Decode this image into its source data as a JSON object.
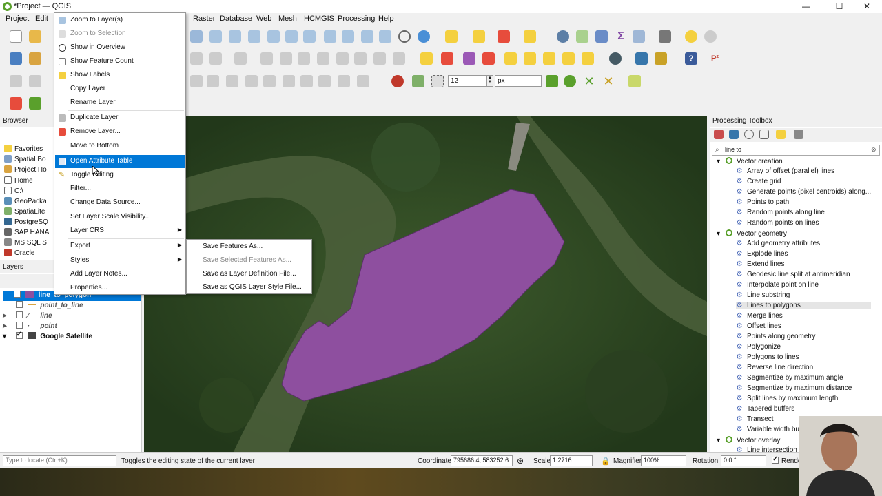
{
  "window": {
    "title": "*Project — QGIS",
    "min": "—",
    "max": "☐",
    "close": "✕"
  },
  "menubar": [
    "Project",
    "Edit",
    "Raster",
    "Database",
    "Web",
    "Mesh",
    "HCMGIS",
    "Processing",
    "Help"
  ],
  "snapping": {
    "tolerance_value": "12",
    "units_value": "px"
  },
  "browser": {
    "title": "Browser",
    "items": [
      "Favorites",
      "Spatial Bo",
      "Project Ho",
      "Home",
      "C:\\",
      "GeoPacka",
      "SpatiaLite",
      "PostgreSQ",
      "SAP HANA",
      "MS SQL S",
      "Oracle"
    ]
  },
  "layers": {
    "title": "Layers",
    "items": [
      {
        "name": "line_to_polygon",
        "checked": true,
        "selected": true
      },
      {
        "name": "point_to_line",
        "checked": false
      },
      {
        "name": "line",
        "checked": false
      },
      {
        "name": "point",
        "checked": false
      },
      {
        "name": "Google Satellite",
        "checked": true
      }
    ]
  },
  "context_menu": {
    "items": [
      {
        "label": "Zoom to Layer(s)"
      },
      {
        "label": "Zoom to Selection",
        "disabled": true
      },
      {
        "label": "Show in Overview"
      },
      {
        "label": "Show Feature Count"
      },
      {
        "label": "Show Labels"
      },
      {
        "label": "Copy Layer"
      },
      {
        "label": "Rename Layer"
      },
      {
        "label": "Duplicate Layer"
      },
      {
        "label": "Remove Layer..."
      },
      {
        "label": "Move to Bottom"
      },
      {
        "label": "Open Attribute Table",
        "highlighted": true
      },
      {
        "label": "Toggle Editing"
      },
      {
        "label": "Filter..."
      },
      {
        "label": "Change Data Source..."
      },
      {
        "label": "Set Layer Scale Visibility..."
      },
      {
        "label": "Layer CRS"
      },
      {
        "label": "Export"
      },
      {
        "label": "Styles"
      },
      {
        "label": "Add Layer Notes..."
      },
      {
        "label": "Properties..."
      }
    ]
  },
  "export_submenu": {
    "items": [
      {
        "label": "Save Features As..."
      },
      {
        "label": "Save Selected Features As...",
        "disabled": true
      },
      {
        "label": "Save as Layer Definition File..."
      },
      {
        "label": "Save as QGIS Layer Style File..."
      }
    ]
  },
  "processing": {
    "title": "Processing Toolbox",
    "search": "line to",
    "groups": [
      {
        "name": "Vector creation",
        "items": [
          "Array of offset (parallel) lines",
          "Create grid",
          "Generate points (pixel centroids) along...",
          "Points to path",
          "Random points along line",
          "Random points on lines"
        ]
      },
      {
        "name": "Vector geometry",
        "items": [
          "Add geometry attributes",
          "Explode lines",
          "Extend lines",
          "Geodesic line split at antimeridian",
          "Interpolate point on line",
          "Line substring",
          "Lines to polygons",
          "Merge lines",
          "Offset lines",
          "Points along geometry",
          "Polygonize",
          "Polygons to lines",
          "Reverse line direction",
          "Segmentize by maximum angle",
          "Segmentize by maximum distance",
          "Split lines by maximum length",
          "Tapered buffers",
          "Transect",
          "Variable width bu"
        ]
      },
      {
        "name": "Vector overlay",
        "items": [
          "Line intersection"
        ]
      }
    ]
  },
  "statusbar": {
    "locator_placeholder": "Type to locate (Ctrl+K)",
    "message": "Toggles the editing state of the current layer",
    "coordinate_label": "Coordinate",
    "coordinate_value": "795686.4, 583252.6",
    "scale_label": "Scale",
    "scale_value": "1:2716",
    "magnifier_label": "Magnifier",
    "magnifier_value": "100%",
    "rotation_label": "Rotation",
    "rotation_value": "0.0 °",
    "render_label": "Rende"
  },
  "colors": {
    "polygon_fill": "#8e4f9f",
    "highlight": "#0078d7",
    "qgis_green": "#5aa02c"
  }
}
